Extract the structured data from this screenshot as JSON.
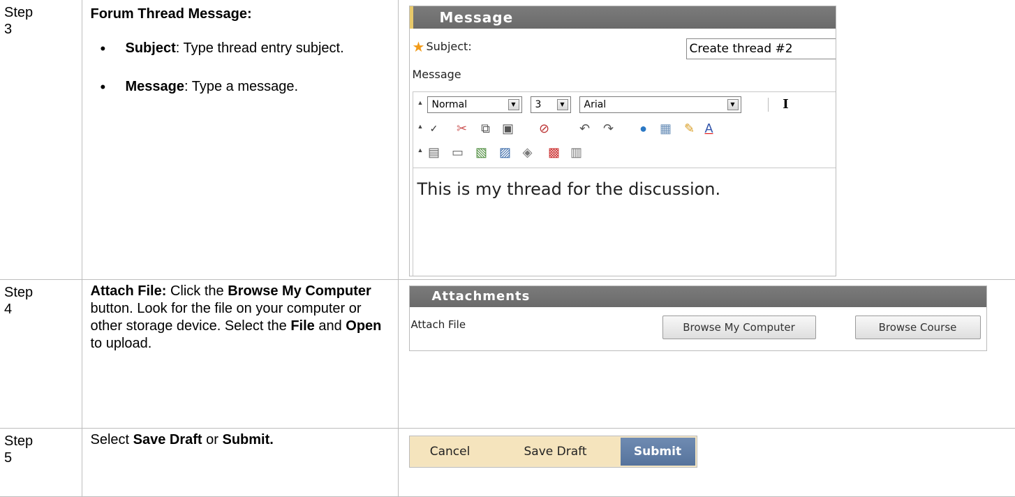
{
  "rows": [
    {
      "step": [
        "Step",
        "3"
      ],
      "title": "Forum Thread Message:",
      "bullets": [
        {
          "bold": "Subject",
          "rest": ": Type thread entry subject."
        },
        {
          "bold": "Message",
          "rest": ": Type a message."
        }
      ]
    },
    {
      "step": [
        "Step",
        "4"
      ],
      "parts": {
        "b1": "Attach File:",
        "t1": " Click the ",
        "b2": "Browse My Computer",
        "t2": " button. Look for the file on your computer or other storage device. Select the ",
        "b3": "File",
        "t3": " and ",
        "b4": "Open",
        "t4": " to upload."
      }
    },
    {
      "step": [
        "Step",
        "5"
      ],
      "parts": {
        "t1": "Select ",
        "b1": "Save Draft",
        "t2": " or ",
        "b2": "Submit."
      }
    }
  ],
  "message_panel": {
    "header": "Message",
    "subject_label": "Subject:",
    "subject_value": "Create thread #2",
    "message_label": "Message",
    "format_select": "Normal",
    "size_select": "3",
    "font_select": "Arial",
    "body_text": "This is my thread for the discussion."
  },
  "attachments_panel": {
    "header": "Attachments",
    "attach_label": "Attach File",
    "browse_computer": "Browse My Computer",
    "browse_course": "Browse Course"
  },
  "submit_bar": {
    "cancel": "Cancel",
    "save_draft": "Save Draft",
    "submit": "Submit"
  }
}
